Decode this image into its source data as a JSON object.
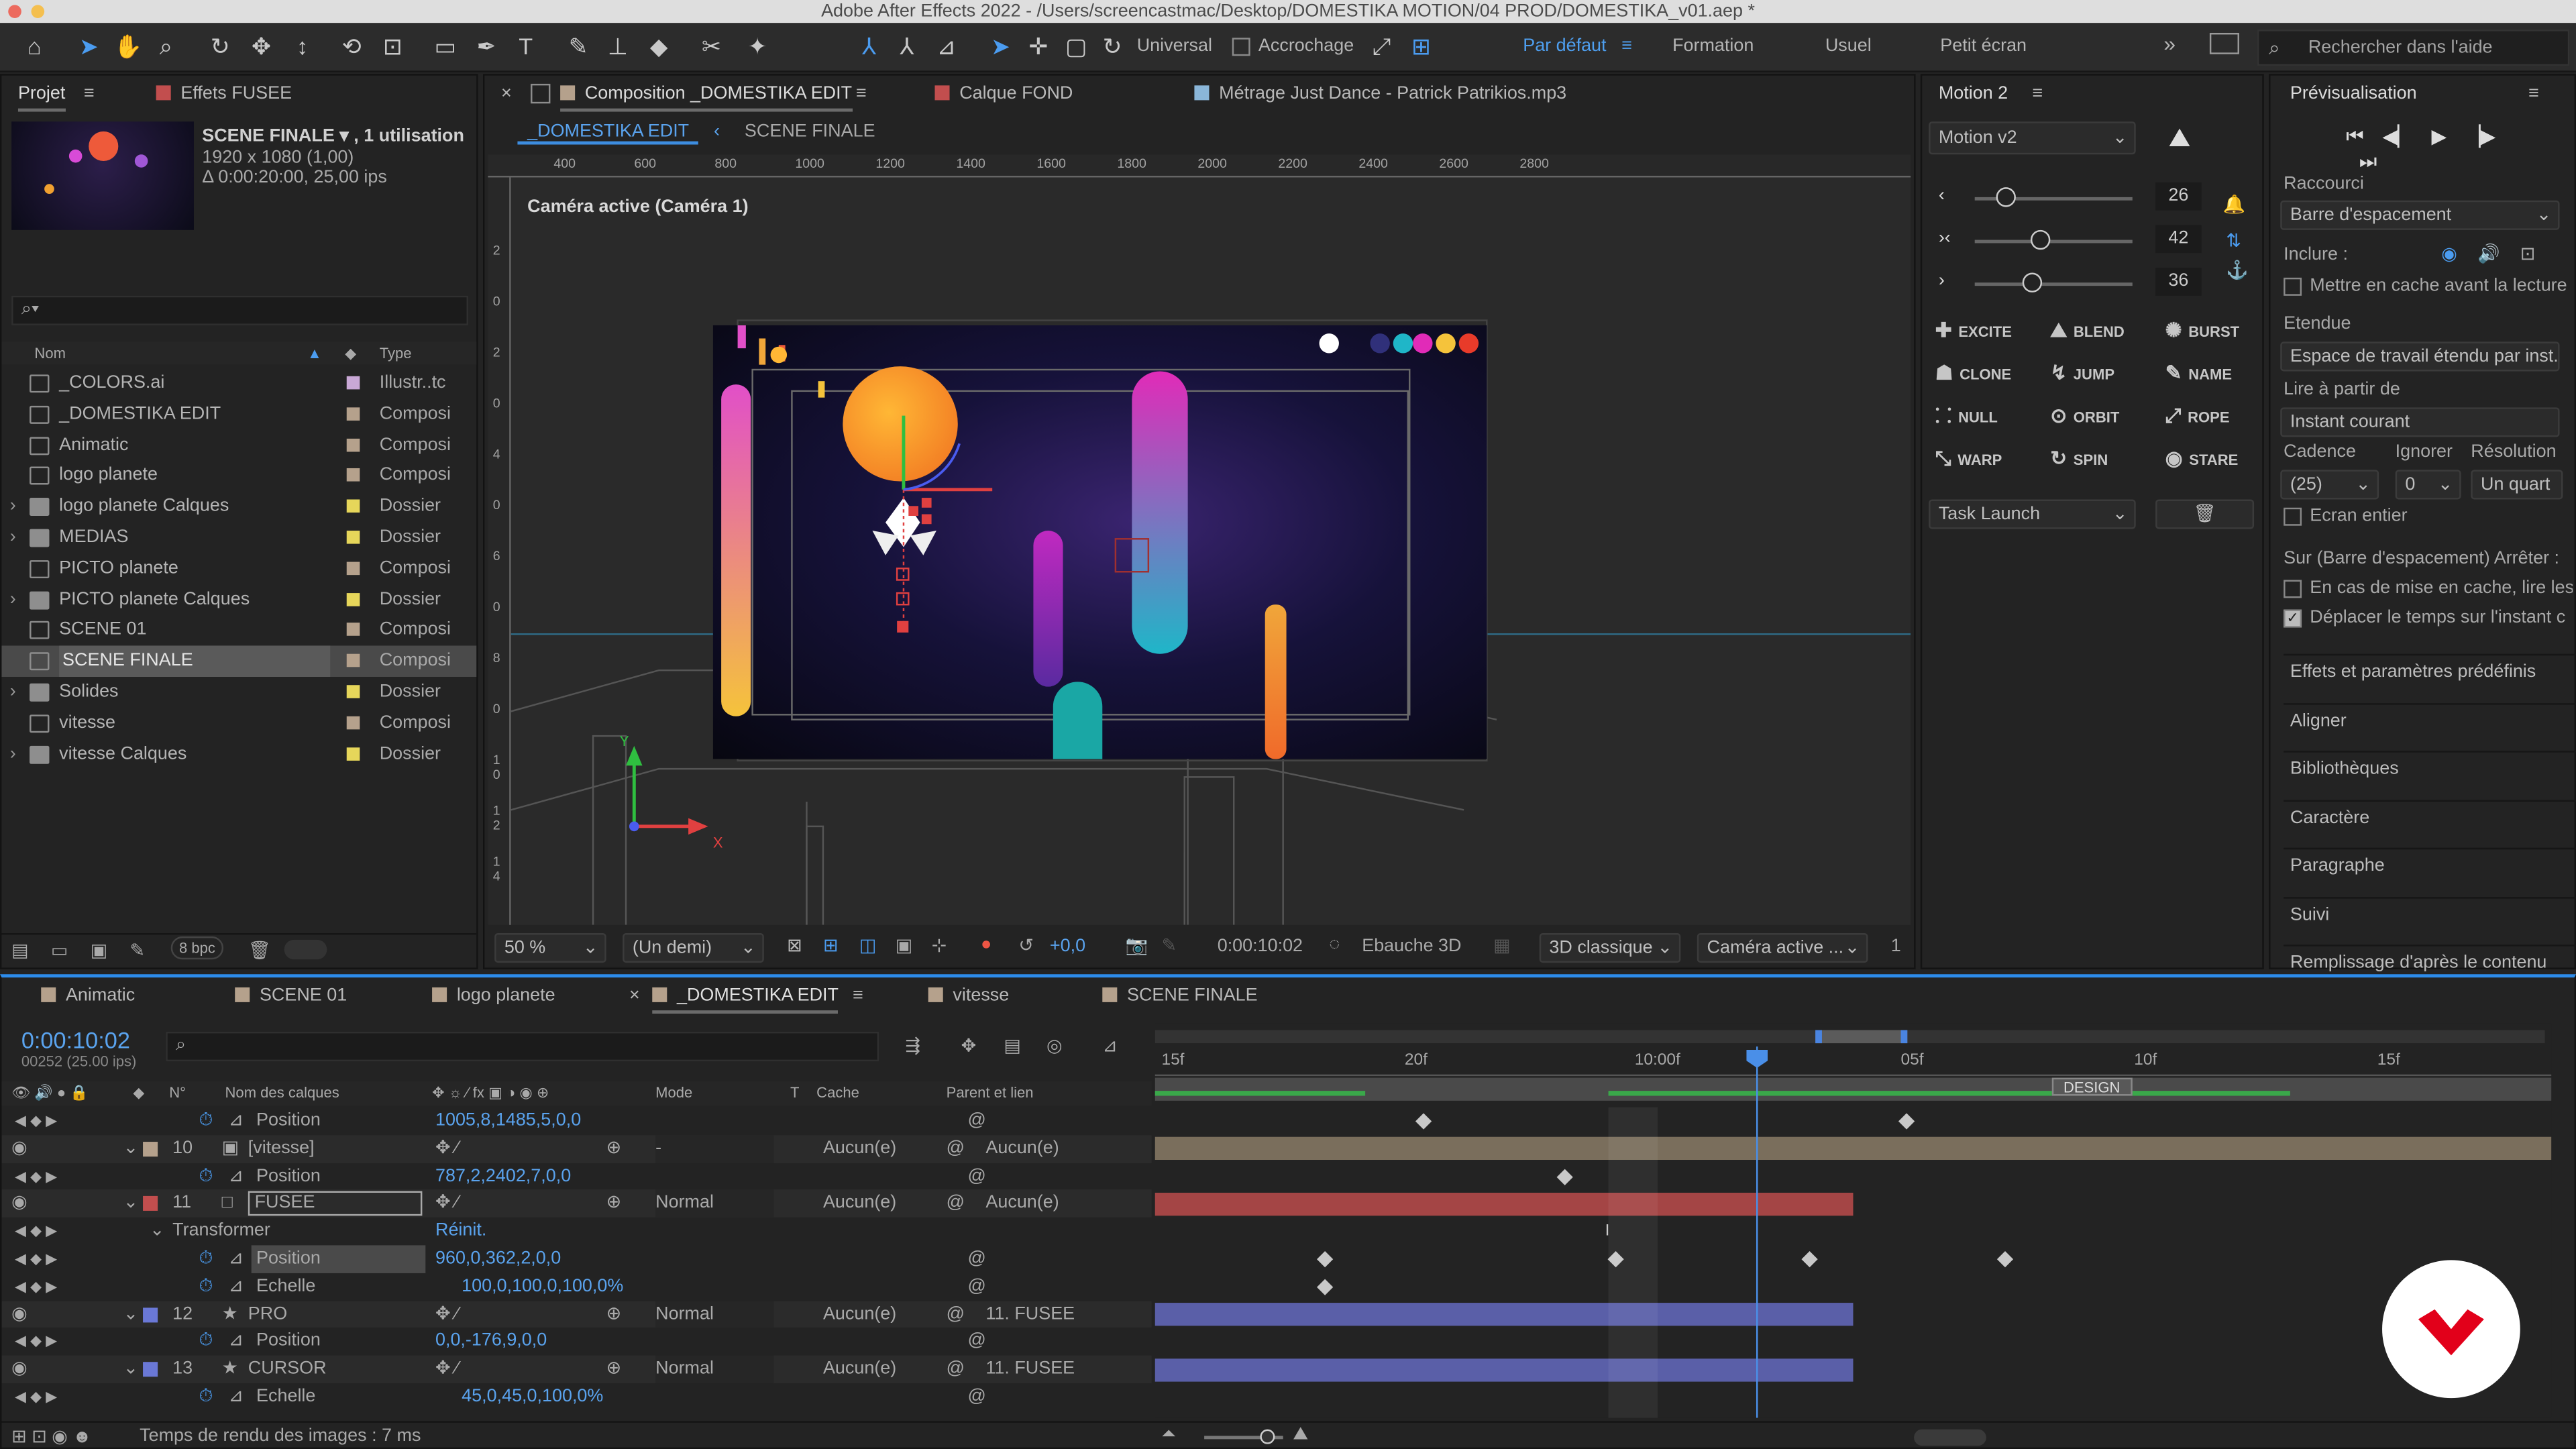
{
  "title": "Adobe After Effects 2022 - /Users/screencastmac/Desktop/DOMESTIKA MOTION/04 PROD/DOMESTIKA_v01.aep *",
  "toolbar": {
    "universal": "Universal",
    "snapping": "Accrochage",
    "workspaces": [
      "Par défaut",
      "Formation",
      "Usuel",
      "Petit écran"
    ],
    "search_placeholder": "Rechercher dans l'aide"
  },
  "project": {
    "tab": "Projet",
    "effects_tab": "Effets  FUSEE",
    "selected_name": "SCENE FINALE ▾ , 1 utilisation",
    "selected_size": "1920 x 1080 (1,00)",
    "selected_time": "Δ 0:00:20:00, 25,00 ips",
    "col_name": "Nom",
    "col_type": "Type",
    "bpc": "8 bpc",
    "items": [
      {
        "name": "_COLORS.ai",
        "type": "Illustr..tc",
        "color": "#c9a8d6",
        "kind": "file",
        "arrow": ""
      },
      {
        "name": "_DOMESTIKA EDIT",
        "type": "Composi",
        "color": "#b5a18c",
        "kind": "comp",
        "arrow": ""
      },
      {
        "name": "Animatic",
        "type": "Composi",
        "color": "#b5a18c",
        "kind": "comp",
        "arrow": ""
      },
      {
        "name": "logo planete",
        "type": "Composi",
        "color": "#b5a18c",
        "kind": "comp",
        "arrow": ""
      },
      {
        "name": "logo planete Calques",
        "type": "Dossier",
        "color": "#e6d65a",
        "kind": "folder",
        "arrow": "›"
      },
      {
        "name": "MEDIAS",
        "type": "Dossier",
        "color": "#e6d65a",
        "kind": "folder",
        "arrow": "›"
      },
      {
        "name": "PICTO planete",
        "type": "Composi",
        "color": "#b5a18c",
        "kind": "comp",
        "arrow": ""
      },
      {
        "name": "PICTO planete Calques",
        "type": "Dossier",
        "color": "#e6d65a",
        "kind": "folder",
        "arrow": "›"
      },
      {
        "name": "SCENE 01",
        "type": "Composi",
        "color": "#b5a18c",
        "kind": "comp",
        "arrow": ""
      },
      {
        "name": "SCENE FINALE",
        "type": "Composi",
        "color": "#b5a18c",
        "kind": "comp",
        "arrow": "",
        "selected": true
      },
      {
        "name": "Solides",
        "type": "Dossier",
        "color": "#e6d65a",
        "kind": "folder",
        "arrow": "›"
      },
      {
        "name": "vitesse",
        "type": "Composi",
        "color": "#b5a18c",
        "kind": "comp",
        "arrow": ""
      },
      {
        "name": "vitesse Calques",
        "type": "Dossier",
        "color": "#e6d65a",
        "kind": "folder",
        "arrow": "›"
      }
    ]
  },
  "viewer": {
    "tabs": [
      "Composition  _DOMESTIKA EDIT",
      "Calque  FOND",
      "Métrage  Just Dance - Patrick Patrikios.mp3"
    ],
    "breadcrumbs": [
      "_DOMESTIKA EDIT",
      "SCENE FINALE"
    ],
    "camera_label": "Caméra active (Caméra 1)",
    "ruler_ticks": [
      "400",
      "600",
      "800",
      "1000",
      "1200",
      "1400",
      "1600",
      "1800",
      "2000",
      "2200",
      "2400",
      "2600",
      "2800"
    ],
    "vruler_ticks": [
      "2",
      "0",
      "2",
      "0",
      "4",
      "0",
      "6",
      "0",
      "8",
      "0",
      "1 0",
      "1 2",
      "1 4"
    ],
    "zoom": "50 %",
    "resolution": "(Un demi)",
    "exposure": "+0,0",
    "time": "0:00:10:02",
    "draft": "Ebauche 3D",
    "renderer": "3D classique",
    "view": "Caméra active ...",
    "views_count": "1",
    "axis_x": "X",
    "axis_y": "Y"
  },
  "motion": {
    "tab": "Motion 2",
    "preset": "Motion v2",
    "sliders": [
      {
        "value": "26",
        "level": 0.2
      },
      {
        "value": "42",
        "level": 0.42
      },
      {
        "value": "36",
        "level": 0.36
      }
    ],
    "buttons": [
      "EXCITE",
      "BLEND",
      "BURST",
      "CLONE",
      "JUMP",
      "NAME",
      "NULL",
      "ORBIT",
      "ROPE",
      "WARP",
      "SPIN",
      "STARE"
    ],
    "task": "Task Launch"
  },
  "preview": {
    "tab": "Prévisualisation",
    "shortcut_label": "Raccourci",
    "shortcut": "Barre d'espacement",
    "include": "Inclure :",
    "cache_before": "Mettre en cache avant la lecture",
    "range_label": "Etendue",
    "range": "Espace de travail étendu par inst...",
    "play_from_label": "Lire à partir de",
    "play_from": "Instant courant",
    "cadence_label": "Cadence",
    "skip_label": "Ignorer",
    "res_label": "Résolution",
    "cadence": "(25)",
    "skip": "0",
    "res": "Un quart",
    "fullscreen": "Ecran entier",
    "stop_label": "Sur (Barre d'espacement) Arrêter :",
    "opt1": "En cas de mise en cache, lire les",
    "opt2": "Déplacer le temps sur l'instant c"
  },
  "sidepanels": [
    "Effets et paramètres prédéfinis",
    "Aligner",
    "Bibliothèques",
    "Caractère",
    "Paragraphe",
    "Suivi",
    "Remplissage d'après le contenu"
  ],
  "timeline": {
    "tabs": [
      "Animatic",
      "SCENE 01",
      "logo planete",
      "_DOMESTIKA EDIT",
      "vitesse",
      "SCENE FINALE"
    ],
    "timecode": "0:00:10:02",
    "frames": "00252 (25.00 ips)",
    "headers": {
      "num": "N°",
      "name": "Nom des calques",
      "mode": "Mode",
      "t": "T",
      "cache": "Cache",
      "parent": "Parent et lien"
    },
    "ruler": [
      "15f",
      "20f",
      "10:00f",
      "05f",
      "10f",
      "15f"
    ],
    "marker": "DESIGN",
    "rows": [
      {
        "type": "prop",
        "name": "Position",
        "value": "1005,8,1485,5,0,0",
        "indent": 1
      },
      {
        "type": "layer",
        "num": "10",
        "name": "[vitesse]",
        "mode": "-",
        "cache": "Aucun(e)",
        "parent": "Aucun(e)",
        "color": "#b5a18c",
        "icon": "comp"
      },
      {
        "type": "prop",
        "name": "Position",
        "value": "787,2,2402,7,0,0",
        "indent": 1
      },
      {
        "type": "layer",
        "num": "11",
        "name": "FUSEE",
        "mode": "Normal",
        "cache": "Aucun(e)",
        "parent": "Aucun(e)",
        "color": "#c24e4e",
        "icon": "solid",
        "selected": true
      },
      {
        "type": "group",
        "name": "Transformer",
        "value": "Réinit.",
        "indent": 0
      },
      {
        "type": "prop",
        "name": "Position",
        "value": "960,0,362,2,0,0",
        "indent": 1,
        "selected": true
      },
      {
        "type": "prop",
        "name": "Echelle",
        "value": "100,0,100,0,100,0%",
        "indent": 1
      },
      {
        "type": "layer",
        "num": "12",
        "name": "PRO",
        "mode": "Normal",
        "cache": "Aucun(e)",
        "parent": "11. FUSEE",
        "color": "#6a78d6",
        "icon": "star"
      },
      {
        "type": "prop",
        "name": "Position",
        "value": "0,0,-176,9,0,0",
        "indent": 1
      },
      {
        "type": "layer",
        "num": "13",
        "name": "CURSOR",
        "mode": "Normal",
        "cache": "Aucun(e)",
        "parent": "11. FUSEE",
        "color": "#6a78d6",
        "icon": "star"
      },
      {
        "type": "prop",
        "name": "Echelle",
        "value": "45,0,45,0,100,0%",
        "indent": 1
      }
    ],
    "render_time": "Temps de rendu des images : 7 ms"
  },
  "colors": {
    "accent": "#2d8ceb",
    "brand": "#e2001a"
  }
}
